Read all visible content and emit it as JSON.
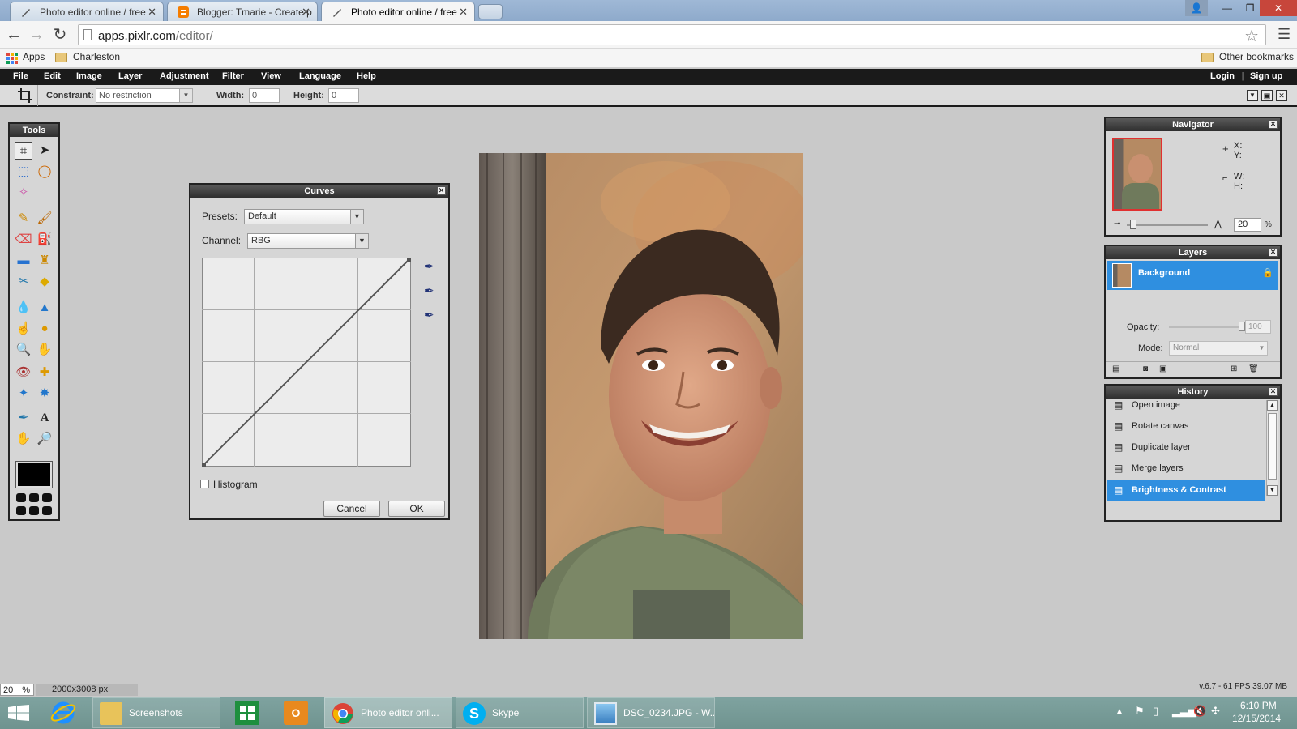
{
  "browser": {
    "tabs": [
      {
        "title": "Photo editor online / free"
      },
      {
        "title": "Blogger: Tmarie - Create p"
      },
      {
        "title": "Photo editor online / free"
      }
    ],
    "url_host": "apps.pixlr.com",
    "url_path": "/editor/",
    "bookmarks": {
      "apps": "Apps",
      "folder1": "Charleston",
      "other": "Other bookmarks"
    }
  },
  "menu": {
    "items": [
      "File",
      "Edit",
      "Image",
      "Layer",
      "Adjustment",
      "Filter",
      "View",
      "Language",
      "Help"
    ],
    "login": "Login",
    "separator": "|",
    "signup": "Sign up"
  },
  "options": {
    "constraint_label": "Constraint:",
    "constraint_value": "No restriction",
    "width_label": "Width:",
    "width_value": "0",
    "height_label": "Height:",
    "height_value": "0"
  },
  "tools": {
    "title": "Tools"
  },
  "curves": {
    "title": "Curves",
    "presets_label": "Presets:",
    "presets_value": "Default",
    "channel_label": "Channel:",
    "channel_value": "RBG",
    "histogram_label": "Histogram",
    "cancel": "Cancel",
    "ok": "OK"
  },
  "navigator": {
    "title": "Navigator",
    "x_label": "X:",
    "y_label": "Y:",
    "w_label": "W:",
    "h_label": "H:",
    "zoom_value": "20",
    "zoom_unit": "%",
    "zoom_slider_level": 0.08
  },
  "layers": {
    "title": "Layers",
    "layer_name": "Background",
    "opacity_label": "Opacity:",
    "opacity_value": "100",
    "mode_label": "Mode:",
    "mode_value": "Normal"
  },
  "history": {
    "title": "History",
    "items": [
      "Open image",
      "Rotate canvas",
      "Duplicate layer",
      "Merge layers",
      "Brightness & Contrast"
    ],
    "selected_index": 4
  },
  "status": {
    "zoom": "20",
    "zoom_unit": "%",
    "dimensions": "2000x3008 px",
    "version": "v.6.7 - 61 FPS 39.07 MB"
  },
  "taskbar": {
    "buttons": [
      {
        "label": "Screenshots"
      },
      {
        "label": "Photo editor onli..."
      },
      {
        "label": "Skype"
      },
      {
        "label": "DSC_0234.JPG - W..."
      }
    ],
    "time": "6:10 PM",
    "date": "12/15/2014"
  },
  "colors": {
    "selection_blue": "#2f8fe0",
    "foreground_color": "#000000"
  }
}
